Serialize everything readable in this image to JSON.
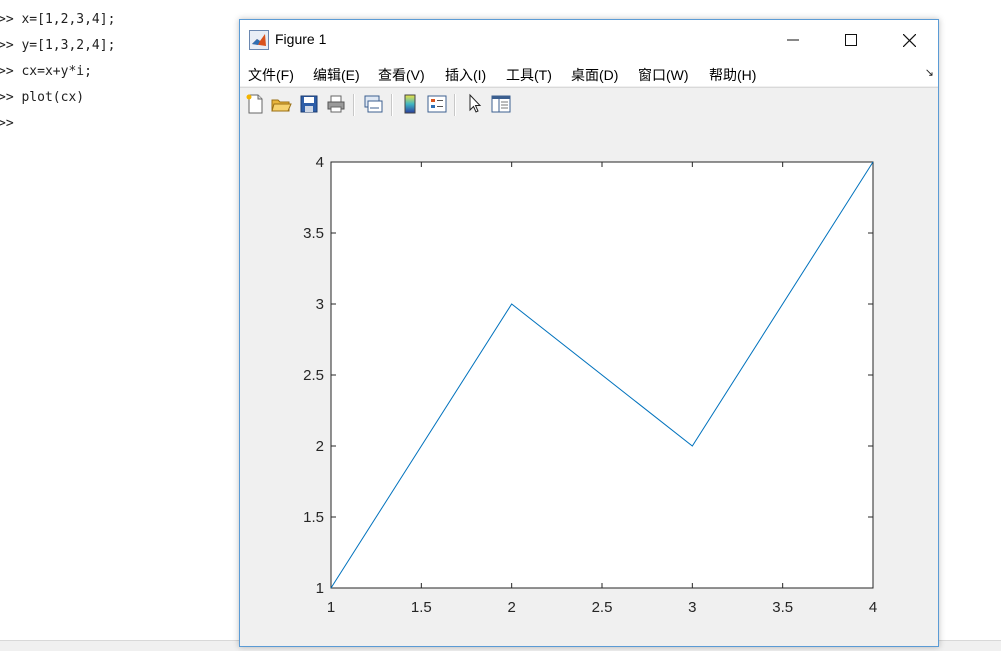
{
  "console": {
    "lines": [
      ">> x=[1,2,3,4];",
      ">> y=[1,3,2,4];",
      ">> cx=x+y*i;",
      ">> plot(cx)",
      ">>"
    ]
  },
  "figure": {
    "title": "Figure 1",
    "menu": [
      "文件(F)",
      "编辑(E)",
      "查看(V)",
      "插入(I)",
      "工具(T)",
      "桌面(D)",
      "窗口(W)",
      "帮助(H)"
    ],
    "dock_arrow": "↘",
    "toolbar_icons": [
      "new-figure-icon",
      "open-file-icon",
      "save-icon",
      "print-icon",
      "link-plot-icon",
      "colorbar-icon",
      "legend-icon",
      "pointer-icon",
      "property-inspector-icon"
    ]
  },
  "colors": {
    "line": "#0072bd",
    "window_border": "#5b9bd5",
    "figure_bg": "#f0f0f0"
  },
  "chart_data": {
    "type": "line",
    "x": [
      1,
      2,
      3,
      4
    ],
    "series": [
      {
        "values": [
          1,
          3,
          2,
          4
        ]
      }
    ],
    "xlim": [
      1,
      4
    ],
    "ylim": [
      1,
      4
    ],
    "xticks": [
      "1",
      "1.5",
      "2",
      "2.5",
      "3",
      "3.5",
      "4"
    ],
    "yticks": [
      "1",
      "1.5",
      "2",
      "2.5",
      "3",
      "3.5",
      "4"
    ],
    "grid": false
  }
}
